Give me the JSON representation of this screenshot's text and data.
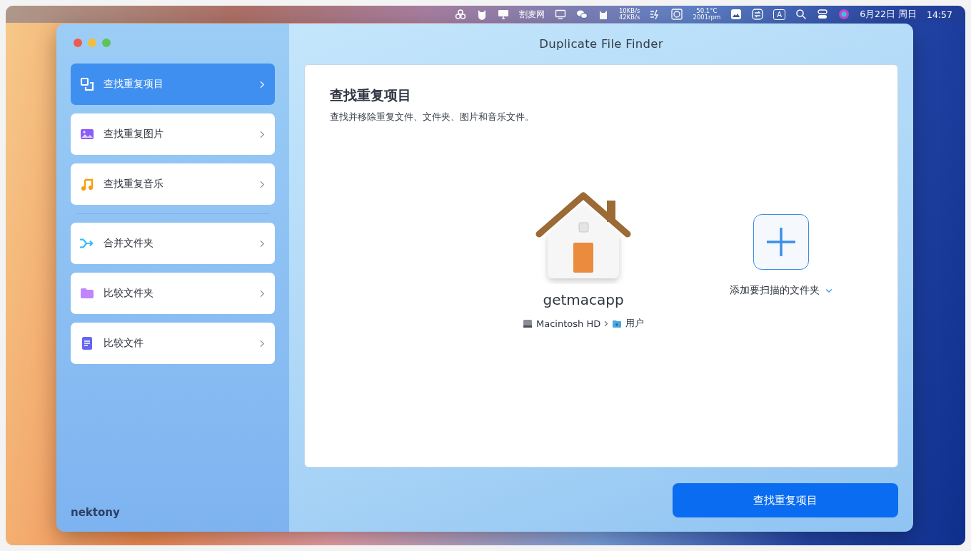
{
  "menu_bar": {
    "app_text": "割麦网",
    "network": [
      "10KB/s",
      "42KB/s"
    ],
    "sensors": [
      "50.1°C",
      "2001rpm"
    ],
    "input_badge": "A",
    "date": "6月22日 周日",
    "time": "14:57"
  },
  "window": {
    "title": "Duplicate File Finder"
  },
  "sidebar": {
    "groups": [
      [
        {
          "label": "查找重复项目",
          "selected": true
        },
        {
          "label": "查找重复图片",
          "selected": false
        },
        {
          "label": "查找重复音乐",
          "selected": false
        }
      ],
      [
        {
          "label": "合并文件夹",
          "selected": false
        },
        {
          "label": "比较文件夹",
          "selected": false
        },
        {
          "label": "比较文件",
          "selected": false
        }
      ]
    ],
    "logo": "nektony"
  },
  "panel": {
    "title": "查找重复项目",
    "subtitle": "查找并移除重复文件、文件夹、图片和音乐文件。",
    "folder": {
      "name": "getmacapp",
      "path": [
        "Macintosh HD",
        "用户"
      ]
    },
    "add_label": "添加要扫描的文件夹"
  },
  "primary_button": "查找重复项目"
}
